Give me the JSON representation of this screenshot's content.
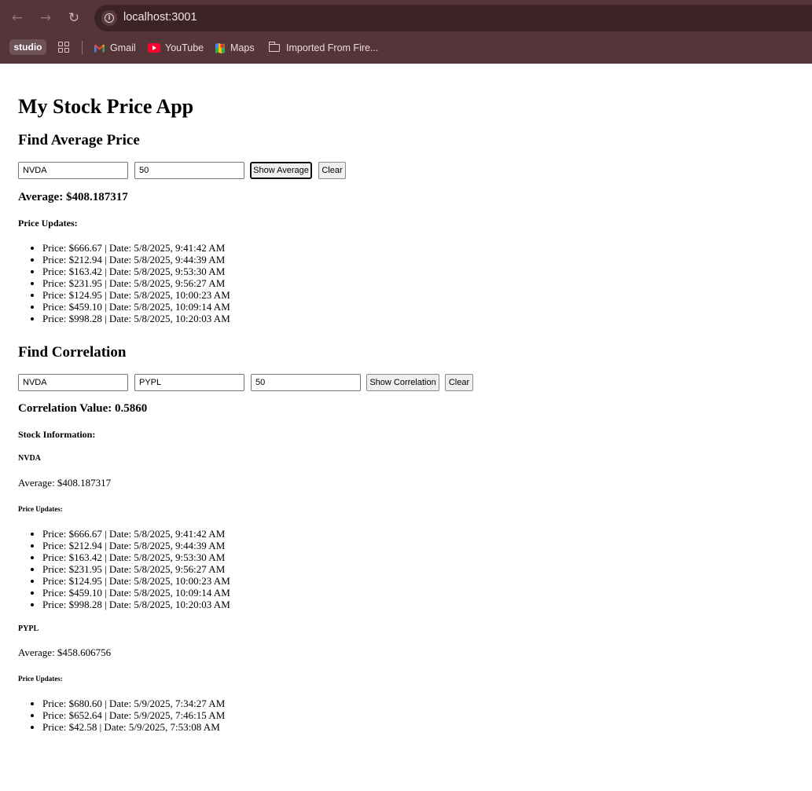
{
  "browser": {
    "url": "localhost:3001",
    "bookmarks": [
      {
        "label": "studio",
        "icon": "studio-chip"
      },
      {
        "label": "Gmail",
        "icon": "gmail-icon"
      },
      {
        "label": "YouTube",
        "icon": "youtube-icon"
      },
      {
        "label": "Maps",
        "icon": "maps-icon"
      },
      {
        "label": "Imported From Fire...",
        "icon": "folder-icon"
      }
    ]
  },
  "app": {
    "title": "My Stock Price App"
  },
  "average_section": {
    "heading": "Find Average Price",
    "ticker_value": "NVDA",
    "minutes_value": "50",
    "show_button": "Show Average",
    "clear_button": "Clear",
    "result": "Average: $408.187317",
    "updates_heading": "Price Updates:",
    "updates": [
      "Price: $666.67 | Date: 5/8/2025, 9:41:42 AM",
      "Price: $212.94 | Date: 5/8/2025, 9:44:39 AM",
      "Price: $163.42 | Date: 5/8/2025, 9:53:30 AM",
      "Price: $231.95 | Date: 5/8/2025, 9:56:27 AM",
      "Price: $124.95 | Date: 5/8/2025, 10:00:23 AM",
      "Price: $459.10 | Date: 5/8/2025, 10:09:14 AM",
      "Price: $998.28 | Date: 5/8/2025, 10:20:03 AM"
    ]
  },
  "correlation_section": {
    "heading": "Find Correlation",
    "ticker1_value": "NVDA",
    "ticker2_value": "PYPL",
    "minutes_value": "50",
    "show_button": "Show Correlation",
    "clear_button": "Clear",
    "result": "Correlation Value: 0.5860",
    "info_heading": "Stock Information:",
    "stocks": [
      {
        "ticker": "NVDA",
        "average": "Average: $408.187317",
        "updates_heading": "Price Updates:",
        "updates": [
          "Price: $666.67 | Date: 5/8/2025, 9:41:42 AM",
          "Price: $212.94 | Date: 5/8/2025, 9:44:39 AM",
          "Price: $163.42 | Date: 5/8/2025, 9:53:30 AM",
          "Price: $231.95 | Date: 5/8/2025, 9:56:27 AM",
          "Price: $124.95 | Date: 5/8/2025, 10:00:23 AM",
          "Price: $459.10 | Date: 5/8/2025, 10:09:14 AM",
          "Price: $998.28 | Date: 5/8/2025, 10:20:03 AM"
        ]
      },
      {
        "ticker": "PYPL",
        "average": "Average: $458.606756",
        "updates_heading": "Price Updates:",
        "updates": [
          "Price: $680.60 | Date: 5/9/2025, 7:34:27 AM",
          "Price: $652.64 | Date: 5/9/2025, 7:46:15 AM",
          "Price: $42.58 | Date: 5/9/2025, 7:53:08 AM"
        ]
      }
    ]
  }
}
